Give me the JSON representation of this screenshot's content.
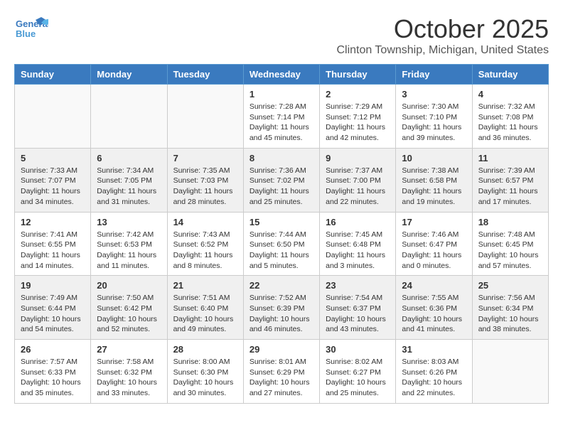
{
  "header": {
    "logo_line1": "General",
    "logo_line2": "Blue",
    "month": "October 2025",
    "location": "Clinton Township, Michigan, United States"
  },
  "days_of_week": [
    "Sunday",
    "Monday",
    "Tuesday",
    "Wednesday",
    "Thursday",
    "Friday",
    "Saturday"
  ],
  "weeks": [
    [
      {
        "day": "",
        "info": ""
      },
      {
        "day": "",
        "info": ""
      },
      {
        "day": "",
        "info": ""
      },
      {
        "day": "1",
        "info": "Sunrise: 7:28 AM\nSunset: 7:14 PM\nDaylight: 11 hours\nand 45 minutes."
      },
      {
        "day": "2",
        "info": "Sunrise: 7:29 AM\nSunset: 7:12 PM\nDaylight: 11 hours\nand 42 minutes."
      },
      {
        "day": "3",
        "info": "Sunrise: 7:30 AM\nSunset: 7:10 PM\nDaylight: 11 hours\nand 39 minutes."
      },
      {
        "day": "4",
        "info": "Sunrise: 7:32 AM\nSunset: 7:08 PM\nDaylight: 11 hours\nand 36 minutes."
      }
    ],
    [
      {
        "day": "5",
        "info": "Sunrise: 7:33 AM\nSunset: 7:07 PM\nDaylight: 11 hours\nand 34 minutes."
      },
      {
        "day": "6",
        "info": "Sunrise: 7:34 AM\nSunset: 7:05 PM\nDaylight: 11 hours\nand 31 minutes."
      },
      {
        "day": "7",
        "info": "Sunrise: 7:35 AM\nSunset: 7:03 PM\nDaylight: 11 hours\nand 28 minutes."
      },
      {
        "day": "8",
        "info": "Sunrise: 7:36 AM\nSunset: 7:02 PM\nDaylight: 11 hours\nand 25 minutes."
      },
      {
        "day": "9",
        "info": "Sunrise: 7:37 AM\nSunset: 7:00 PM\nDaylight: 11 hours\nand 22 minutes."
      },
      {
        "day": "10",
        "info": "Sunrise: 7:38 AM\nSunset: 6:58 PM\nDaylight: 11 hours\nand 19 minutes."
      },
      {
        "day": "11",
        "info": "Sunrise: 7:39 AM\nSunset: 6:57 PM\nDaylight: 11 hours\nand 17 minutes."
      }
    ],
    [
      {
        "day": "12",
        "info": "Sunrise: 7:41 AM\nSunset: 6:55 PM\nDaylight: 11 hours\nand 14 minutes."
      },
      {
        "day": "13",
        "info": "Sunrise: 7:42 AM\nSunset: 6:53 PM\nDaylight: 11 hours\nand 11 minutes."
      },
      {
        "day": "14",
        "info": "Sunrise: 7:43 AM\nSunset: 6:52 PM\nDaylight: 11 hours\nand 8 minutes."
      },
      {
        "day": "15",
        "info": "Sunrise: 7:44 AM\nSunset: 6:50 PM\nDaylight: 11 hours\nand 5 minutes."
      },
      {
        "day": "16",
        "info": "Sunrise: 7:45 AM\nSunset: 6:48 PM\nDaylight: 11 hours\nand 3 minutes."
      },
      {
        "day": "17",
        "info": "Sunrise: 7:46 AM\nSunset: 6:47 PM\nDaylight: 11 hours\nand 0 minutes."
      },
      {
        "day": "18",
        "info": "Sunrise: 7:48 AM\nSunset: 6:45 PM\nDaylight: 10 hours\nand 57 minutes."
      }
    ],
    [
      {
        "day": "19",
        "info": "Sunrise: 7:49 AM\nSunset: 6:44 PM\nDaylight: 10 hours\nand 54 minutes."
      },
      {
        "day": "20",
        "info": "Sunrise: 7:50 AM\nSunset: 6:42 PM\nDaylight: 10 hours\nand 52 minutes."
      },
      {
        "day": "21",
        "info": "Sunrise: 7:51 AM\nSunset: 6:40 PM\nDaylight: 10 hours\nand 49 minutes."
      },
      {
        "day": "22",
        "info": "Sunrise: 7:52 AM\nSunset: 6:39 PM\nDaylight: 10 hours\nand 46 minutes."
      },
      {
        "day": "23",
        "info": "Sunrise: 7:54 AM\nSunset: 6:37 PM\nDaylight: 10 hours\nand 43 minutes."
      },
      {
        "day": "24",
        "info": "Sunrise: 7:55 AM\nSunset: 6:36 PM\nDaylight: 10 hours\nand 41 minutes."
      },
      {
        "day": "25",
        "info": "Sunrise: 7:56 AM\nSunset: 6:34 PM\nDaylight: 10 hours\nand 38 minutes."
      }
    ],
    [
      {
        "day": "26",
        "info": "Sunrise: 7:57 AM\nSunset: 6:33 PM\nDaylight: 10 hours\nand 35 minutes."
      },
      {
        "day": "27",
        "info": "Sunrise: 7:58 AM\nSunset: 6:32 PM\nDaylight: 10 hours\nand 33 minutes."
      },
      {
        "day": "28",
        "info": "Sunrise: 8:00 AM\nSunset: 6:30 PM\nDaylight: 10 hours\nand 30 minutes."
      },
      {
        "day": "29",
        "info": "Sunrise: 8:01 AM\nSunset: 6:29 PM\nDaylight: 10 hours\nand 27 minutes."
      },
      {
        "day": "30",
        "info": "Sunrise: 8:02 AM\nSunset: 6:27 PM\nDaylight: 10 hours\nand 25 minutes."
      },
      {
        "day": "31",
        "info": "Sunrise: 8:03 AM\nSunset: 6:26 PM\nDaylight: 10 hours\nand 22 minutes."
      },
      {
        "day": "",
        "info": ""
      }
    ]
  ]
}
